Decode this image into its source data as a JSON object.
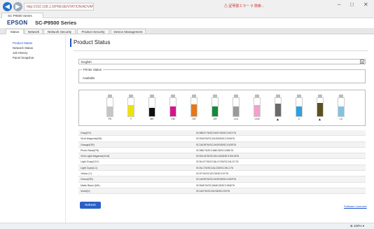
{
  "browser": {
    "tab_label": "SC-P9500 Series",
    "address": "http://192.168.1.5/PRESENTATION/ADVANCED/INFO_PRTINFO/TOP",
    "address_extra": "⚠ 証明書エラー  ⚲  検索...",
    "win_min": "–",
    "win_max": "□",
    "win_close": "✕"
  },
  "header": {
    "brand": "EPSON",
    "model": "SC-P9500 Series"
  },
  "menu_tabs": [
    "Status",
    "Network",
    "Network Security",
    "Product Security",
    "Device Management"
  ],
  "sidebar": {
    "items": [
      "Product Status",
      "Network Status",
      "Job History",
      "Panel Snapshot"
    ]
  },
  "main": {
    "title": "Product Status",
    "language": "English",
    "printer_status_label": "Printer Status",
    "printer_status_value": "Available"
  },
  "inks": [
    {
      "label": "PK",
      "color": "#c5c5c5",
      "level": 0.55,
      "warn": false
    },
    {
      "label": "Y",
      "color": "#f0e200",
      "level": 0.6,
      "warn": false
    },
    {
      "label": "MK",
      "color": "#111111",
      "level": 0.45,
      "warn": false
    },
    {
      "label": "VM",
      "color": "#d5168a",
      "level": 0.55,
      "warn": false
    },
    {
      "label": "OR",
      "color": "#e5781c",
      "level": 0.65,
      "warn": false
    },
    {
      "label": "GR",
      "color": "#168a3b",
      "level": 0.55,
      "warn": false
    },
    {
      "label": "LLK",
      "color": "#9a9a9a",
      "level": 0.55,
      "warn": false
    },
    {
      "label": "VLM",
      "color": "#f3a0cf",
      "level": 0.6,
      "warn": false
    },
    {
      "label": "LK",
      "color": "#6a6a6a",
      "level": 0.7,
      "warn": true
    },
    {
      "label": "C",
      "color": "#2ba2dd",
      "level": 0.55,
      "warn": false
    },
    {
      "label": "VLT",
      "color": "#5a5020",
      "level": 0.75,
      "warn": true
    },
    {
      "label": "LC",
      "color": "#7fc3e2",
      "level": 0.55,
      "warn": false
    }
  ],
  "table": [
    {
      "name": "Gray(GY)",
      "value": "SC9BGY76/SC16GY35/SC19GY76"
    },
    {
      "name": "Vivid Magenta(VM)",
      "value": "SC9VM76/SC16VM35/SC19VM76"
    },
    {
      "name": "Orange(OR)",
      "value": "SC16OR76/SC19OR35/SC19OR76"
    },
    {
      "name": "Photo Black(PK)",
      "value": "SC9BK76/SC16BK35/SC19BK76"
    },
    {
      "name": "Vivid Light Magenta(VLM)",
      "value": "SC9VLM76/SC16VLM35/SC19VLM76"
    },
    {
      "name": "Light Gray(LGY)",
      "value": "SC9LGY76/SC16LGY35/SC19LGY76"
    },
    {
      "name": "Light Cyan(LC)",
      "value": "SC9LC76/SC16LC35/SC19LC76"
    },
    {
      "name": "Yellow (Y)",
      "value": "SC9Y76/SC16Y35/SC19Y76"
    },
    {
      "name": "Green(GR)",
      "value": "SC16GR76/SC19GR35/SC19GR76"
    },
    {
      "name": "Matte Black (MK)",
      "value": "SC9MK76/SC16MK35/SC19MK76"
    },
    {
      "name": "Violet(V)",
      "value": "SC16V76/SC16V35/SC19V76"
    }
  ],
  "buttons": {
    "refresh": "Refresh"
  },
  "links": {
    "license": "Software Licenses"
  },
  "status_bar": {
    "zoom": "⊕ 100% ▾"
  }
}
